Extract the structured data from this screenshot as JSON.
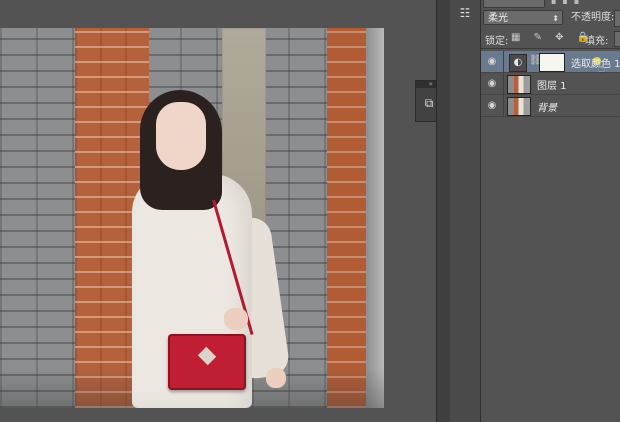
{
  "layers_panel": {
    "blend_mode": "柔光",
    "opacity_label": "不透明度:",
    "lock_label": "锁定:",
    "fill_label": "填充:",
    "lock_icons": "▦ ✎ ✥ 🔒",
    "layers": [
      {
        "name": "选取颜色 1",
        "type": "adjustment",
        "selected": true,
        "visible": true
      },
      {
        "name": "图层 1",
        "type": "pixel",
        "selected": false,
        "visible": true
      },
      {
        "name": "背景",
        "type": "background",
        "selected": false,
        "visible": true
      }
    ]
  },
  "icons": {
    "visibility": "eye-icon",
    "adjustment": "selective-color-icon",
    "link": "chain-link-icon",
    "dock_tool": "sliders-icon",
    "floating": "layer-comp-icon"
  },
  "colors": {
    "workspace": "#535353",
    "selected_row": "#6a7a8e",
    "bag_red": "#c01f33",
    "brick_red": "#b5613c"
  }
}
